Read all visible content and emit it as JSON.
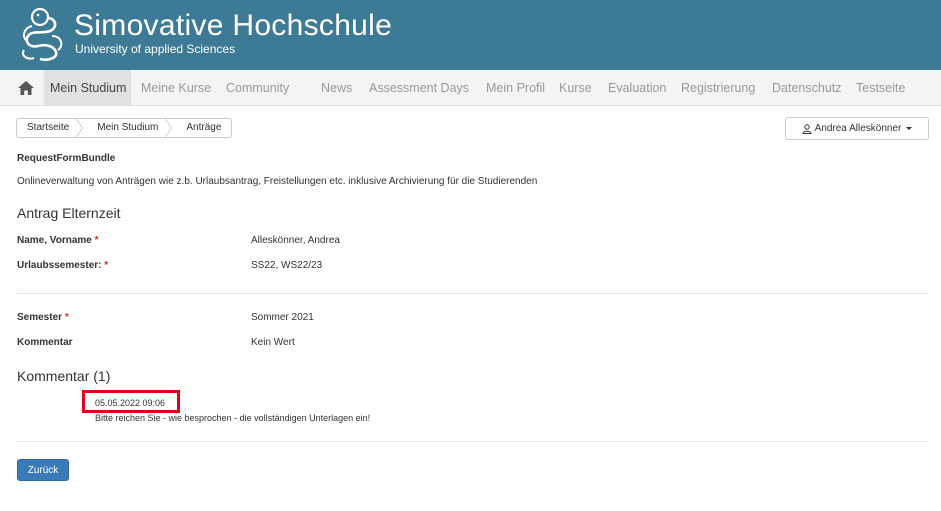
{
  "header": {
    "title": "Simovative  Hochschule",
    "subtitle": "University of applied Sciences",
    "logo_icon": "snake-logo-icon",
    "background": "#3d7a96"
  },
  "nav": {
    "home_icon": "home-icon",
    "items": [
      {
        "label": "Mein Studium",
        "active": true
      },
      {
        "label": "Meine Kurse"
      },
      {
        "label": "Community"
      },
      {
        "label": "News"
      },
      {
        "label": "Assessment Days"
      },
      {
        "label": "Mein Profil"
      },
      {
        "label": "Kurse"
      },
      {
        "label": "Evaluation"
      },
      {
        "label": "Registrierung"
      },
      {
        "label": "Datenschutz"
      },
      {
        "label": "Testseite"
      }
    ]
  },
  "breadcrumb": [
    "Startseite",
    "Mein Studium",
    "Anträge"
  ],
  "user_menu": {
    "label": "Andrea Alleskönner",
    "icon": "user-icon"
  },
  "bundle": {
    "name": "RequestFormBundle",
    "description": "Onlineverwaltung von Anträgen wie z.b. Urlaubsantrag, Freistellungen etc. inklusive Archivierung für die Studierenden"
  },
  "form": {
    "title": "Antrag Elternzeit",
    "required_marker": "*",
    "fields": [
      {
        "label": "Name, Vorname",
        "required": true,
        "value": "Alleskönner, Andrea"
      },
      {
        "label": "Urlaubssemester:",
        "required": true,
        "value": "SS22, WS22/23"
      },
      {
        "label": "Semester",
        "required": true,
        "value": "Sommer 2021"
      },
      {
        "label": "Kommentar",
        "required": false,
        "value": "Kein Wert"
      }
    ]
  },
  "comments": {
    "title": "Kommentar (1)",
    "items": [
      {
        "date": "05.05.2022 09:06",
        "text": "Bitte reichen Sie - wie besprochen - die vollständigen Unterlagen ein!"
      }
    ],
    "highlight_color": "#e0001b"
  },
  "actions": {
    "back_label": "Zurück"
  }
}
